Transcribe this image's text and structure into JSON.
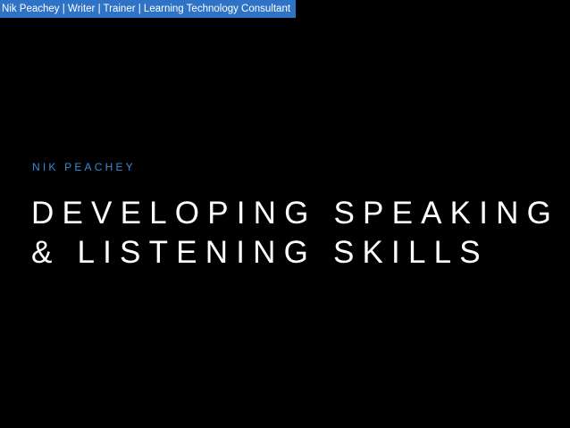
{
  "banner": {
    "text": "Nik Peachey | Writer | Trainer | Learning Technology Consultant"
  },
  "slide": {
    "author": "NIK PEACHEY",
    "title_lines": [
      "DEVELOPING SPEAKING",
      "& LISTENING SKILLS"
    ]
  },
  "colors": {
    "background": "#000000",
    "banner_background": "#2f73c6",
    "author_text": "#3b8bd8",
    "title_text": "#ffffff"
  }
}
